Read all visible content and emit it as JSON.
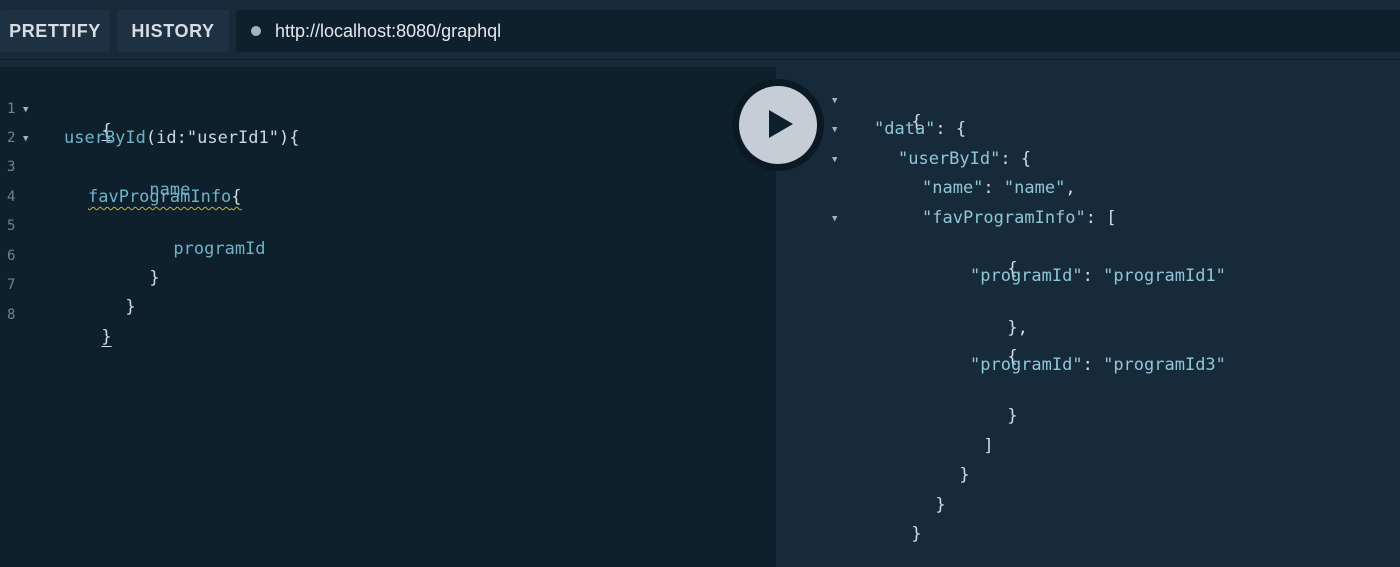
{
  "toolbar": {
    "prettify_label": "PRETTIFY",
    "history_label": "HISTORY",
    "endpoint_url": "http://localhost:8080/graphql"
  },
  "query_editor": {
    "line_numbers": [
      "1",
      "2",
      "3",
      "4",
      "5",
      "6",
      "7",
      "8"
    ],
    "lines": [
      "{",
      "userById(id:\"userId1\"){",
      "name",
      "favProgramInfo{",
      "programId",
      "}",
      "}",
      "}"
    ],
    "tokens": {
      "l2_field": "userById",
      "l2_open_paren": "(",
      "l2_arg": "id",
      "l2_colon": ":",
      "l2_string": "\"userId1\"",
      "l2_close": "){",
      "l4_field": "favProgramInfo",
      "l4_brace": "{"
    }
  },
  "result_viewer": {
    "lines": [
      "{",
      "\"data\": {",
      "\"userById\": {",
      "\"name\": \"name\",",
      "\"favProgramInfo\": [",
      "{",
      "\"programId\": \"programId1\"",
      "},",
      "{",
      "\"programId\": \"programId3\"",
      "}",
      "]",
      "}",
      "}",
      "}"
    ],
    "tokens": {
      "data_key": "\"data\"",
      "userById_key": "\"userById\"",
      "name_key": "\"name\"",
      "name_value": "\"name\"",
      "favProgramInfo_key": "\"favProgramInfo\"",
      "programId_key": "\"programId\"",
      "programId1_value": "\"programId1\"",
      "programId3_value": "\"programId3\""
    }
  },
  "icons": {
    "play": "play-icon",
    "status": "status-dot-icon",
    "fold": "fold-arrow-icon"
  },
  "colors": {
    "editor_bg": "#0f202d",
    "result_bg": "#172a3a",
    "field": "#6fb3c8",
    "key": "#8fc6d8"
  }
}
